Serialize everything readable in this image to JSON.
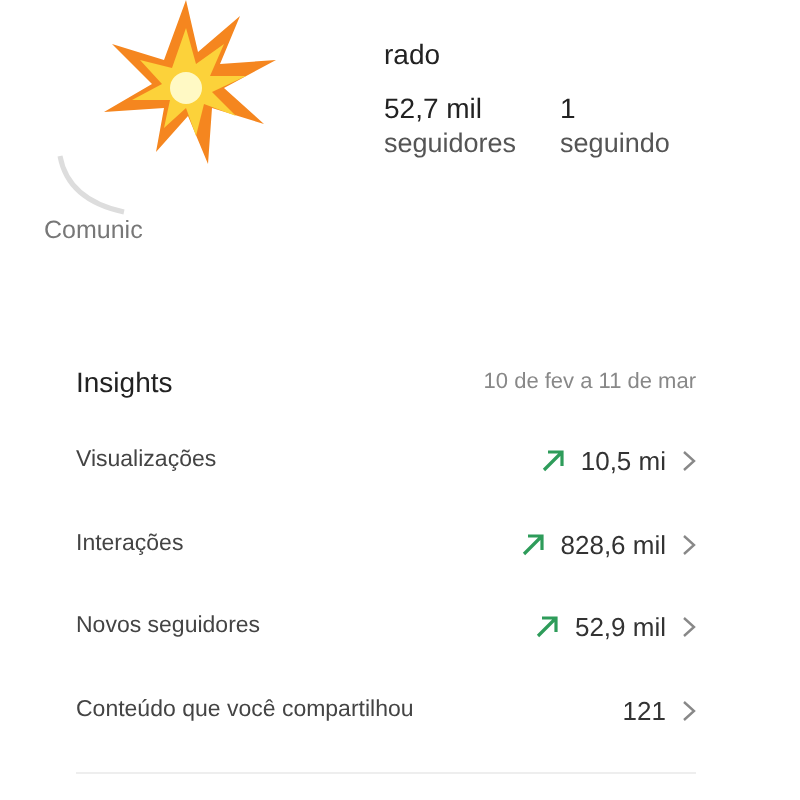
{
  "profile": {
    "name": "rado",
    "stats": [
      {
        "value": "52,7 mil",
        "label": "seguidores"
      },
      {
        "value": "1",
        "label": "seguindo"
      }
    ],
    "category": "Comunic"
  },
  "insights": {
    "title": "Insights",
    "date_range": "10 de fev a 11 de mar",
    "rows": [
      {
        "label": "Visualizações",
        "value": "10,5 mi",
        "trending_up": true
      },
      {
        "label": "Interações",
        "value": "828,6 mil",
        "trending_up": true
      },
      {
        "label": "Novos seguidores",
        "value": "52,9 mil",
        "trending_up": true
      },
      {
        "label": "Conteúdo que você compartilhou",
        "value": "121",
        "trending_up": false
      }
    ]
  }
}
